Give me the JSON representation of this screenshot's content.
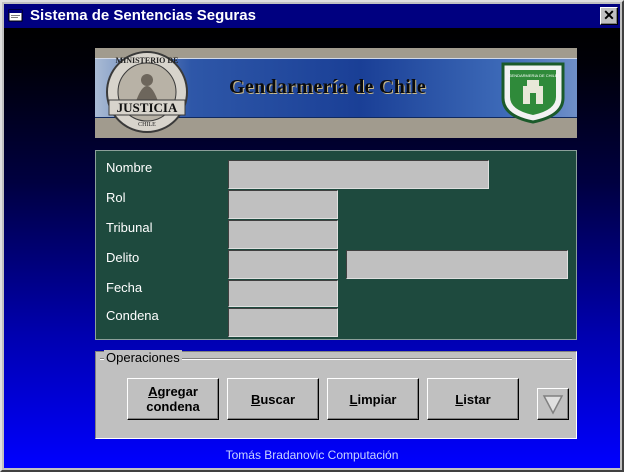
{
  "window": {
    "title": "Sistema de Sentencias Seguras",
    "close_label": "✕"
  },
  "banner": {
    "title": "Gendarmería de Chile",
    "left_seal_text": "JUSTICIA",
    "left_seal_ring": "MINISTERIO DE",
    "left_seal_bottom": "CHILE",
    "right_seal_text": "GENDARMERIA DE CHILE"
  },
  "form": {
    "fields": [
      {
        "label": "Nombre",
        "value": ""
      },
      {
        "label": "Rol",
        "value": ""
      },
      {
        "label": "Tribunal",
        "value": ""
      },
      {
        "label": "Delito",
        "value": "",
        "value2": ""
      },
      {
        "label": "Fecha",
        "value": ""
      },
      {
        "label": "Condena",
        "value": ""
      }
    ]
  },
  "operations": {
    "legend": "Operaciones",
    "agregar_line1_pre": "",
    "agregar_line1_u": "A",
    "agregar_line1_post": "gregar",
    "agregar_line2": "condena",
    "buscar_u": "B",
    "buscar_post": "uscar",
    "limpiar_u": "L",
    "limpiar_post": "impiar",
    "listar_u": "L",
    "listar_post": "istar"
  },
  "footer": {
    "credit": "Tomás Bradanovic Computación"
  },
  "colors": {
    "titlebar": "#000080",
    "form_bg": "#1e4a3e",
    "field_bg": "#c0c0c0",
    "client_gradient_end": "#0000ff"
  },
  "icons": {
    "app": "app-window-icon",
    "close": "close-icon",
    "dropdown": "triangle-down-icon"
  }
}
